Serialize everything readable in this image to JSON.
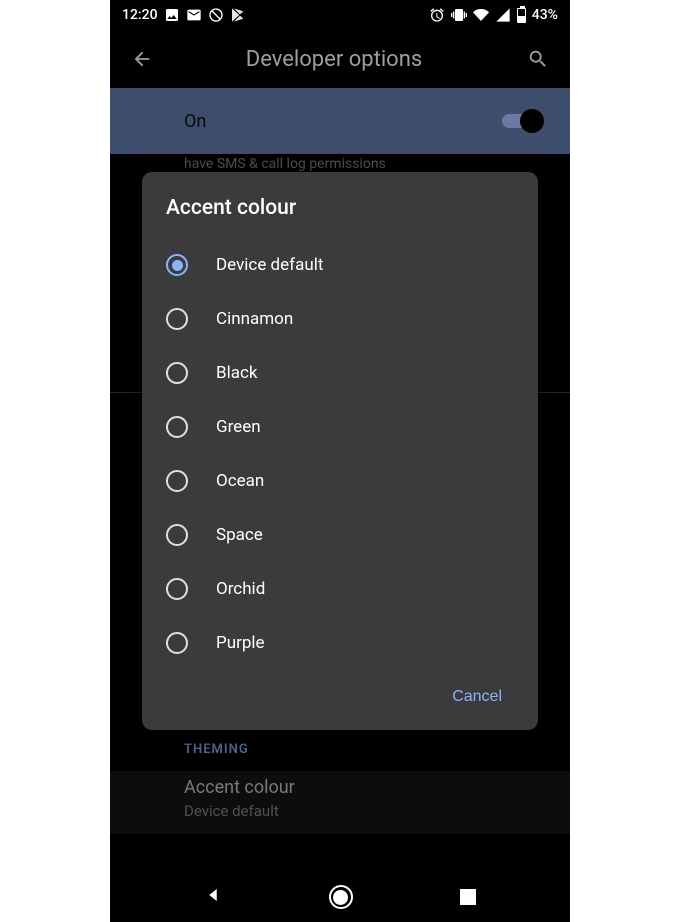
{
  "statusbar": {
    "time": "12:20",
    "battery_pct": "43%"
  },
  "appbar": {
    "title": "Developer options"
  },
  "toggle": {
    "label": "On",
    "enabled": true
  },
  "bg": {
    "partial_text": "have SMS & call log permissions",
    "section_header": "THEMING",
    "pref_title": "Accent colour",
    "pref_sub": "Device default"
  },
  "dialog": {
    "title": "Accent colour",
    "options": [
      "Device default",
      "Cinnamon",
      "Black",
      "Green",
      "Ocean",
      "Space",
      "Orchid",
      "Purple"
    ],
    "selected_index": 0,
    "cancel": "Cancel"
  }
}
